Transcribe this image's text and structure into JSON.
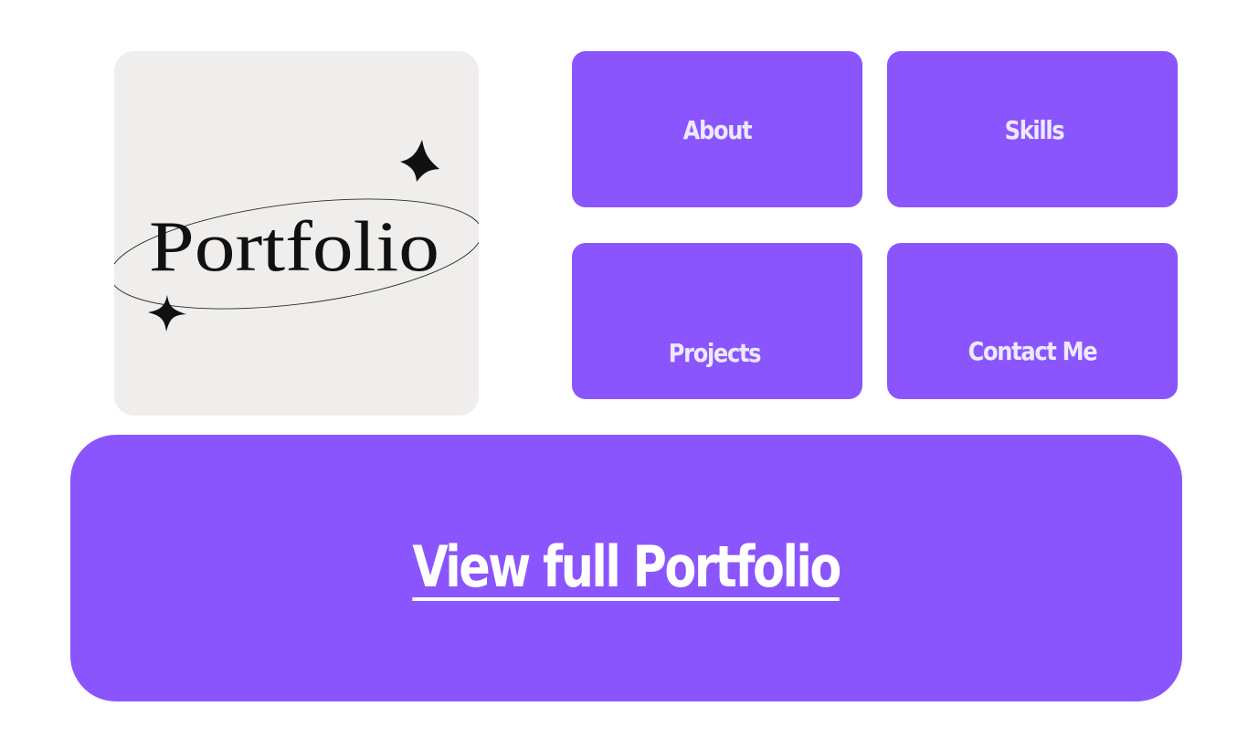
{
  "logo": {
    "text": "Portfolio",
    "background": "#efeeec",
    "ink": "#111111"
  },
  "nav": {
    "about_label": "About",
    "skills_label": "Skills",
    "projects_label": "Projects",
    "contact_label": "Contact Me"
  },
  "banner": {
    "link_label": "View full Portfolio "
  },
  "colors": {
    "accent": "#8b55fd",
    "tile_text": "#ece9ff",
    "banner_text": "#ffffff",
    "page_background": "#ffffff"
  }
}
